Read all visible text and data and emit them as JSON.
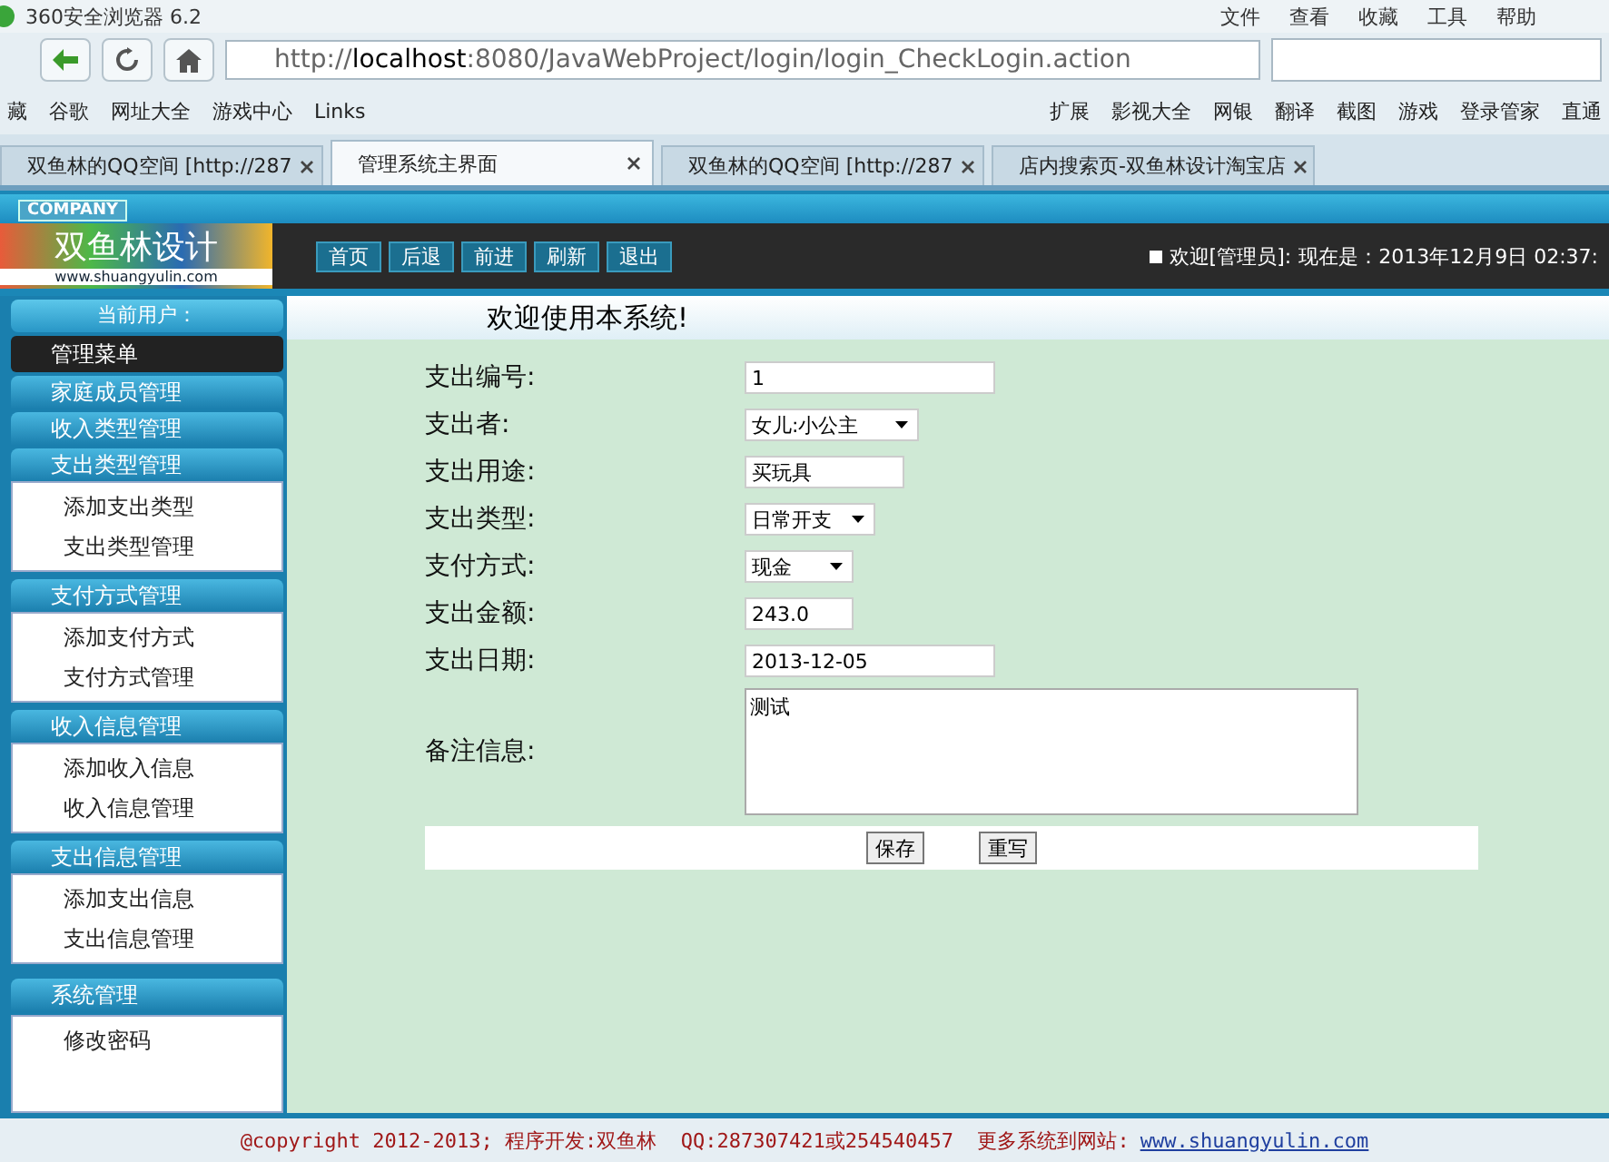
{
  "browser": {
    "title": "360安全浏览器 6.2",
    "menu": [
      "文件",
      "查看",
      "收藏",
      "工具",
      "帮助"
    ],
    "url": "http://**localhost**:8080/JavaWebProject/login/login_CheckLogin.action",
    "bookmarks_left": [
      "藏",
      "谷歌",
      "网址大全",
      "游戏中心",
      "Links"
    ],
    "bookmarks_right": [
      "扩展",
      "影视大全",
      "网银",
      "翻译",
      "截图",
      "游戏",
      "登录管家",
      "直通"
    ],
    "tabs": [
      {
        "label": "双鱼林的QQ空间 [http://287",
        "selected": false
      },
      {
        "label": "管理系统主界面",
        "selected": true
      },
      {
        "label": "双鱼林的QQ空间 [http://287",
        "selected": false
      },
      {
        "label": "店内搜索页-双鱼林设计淘宝店",
        "selected": false
      }
    ]
  },
  "header": {
    "badge": "COMPANY",
    "logo": "双鱼林设计",
    "logo_url": "www.shuangyulin.com",
    "nav": [
      "首页",
      "后退",
      "前进",
      "刷新",
      "退出"
    ],
    "welcome": "欢迎[管理员]:",
    "time": "现在是：2013年12月9日 02:37:"
  },
  "sidebar": {
    "user_label": "当前用户：",
    "menu_title": "管理菜单",
    "groups": [
      {
        "label": "家庭成员管理",
        "expanded": false
      },
      {
        "label": "收入类型管理",
        "expanded": false
      },
      {
        "label": "支出类型管理",
        "expanded": true,
        "children": [
          "添加支出类型",
          "支出类型管理"
        ]
      },
      {
        "label": "支付方式管理",
        "expanded": true,
        "children": [
          "添加支付方式",
          "支付方式管理"
        ]
      },
      {
        "label": "收入信息管理",
        "expanded": true,
        "children": [
          "添加收入信息",
          "收入信息管理"
        ]
      },
      {
        "label": "支出信息管理",
        "expanded": true,
        "children": [
          "添加支出信息",
          "支出信息管理"
        ]
      }
    ],
    "system": {
      "label": "系统管理",
      "children": [
        "修改密码"
      ]
    }
  },
  "main": {
    "title": "欢迎使用本系统!",
    "fields": [
      {
        "kind": "text",
        "label": "支出编号:",
        "value": "1"
      },
      {
        "kind": "select",
        "label": "支出者:",
        "value": "女儿:小公主"
      },
      {
        "kind": "text",
        "label": "支出用途:",
        "value": "买玩具"
      },
      {
        "kind": "select",
        "label": "支出类型:",
        "value": "日常开支"
      },
      {
        "kind": "select",
        "label": "支付方式:",
        "value": "现金"
      },
      {
        "kind": "text",
        "label": "支出金额:",
        "value": "243.0"
      },
      {
        "kind": "text",
        "label": "支出日期:",
        "value": "2013-12-05"
      },
      {
        "kind": "textarea",
        "label": "备注信息:",
        "value": "测试"
      }
    ],
    "buttons": [
      "保存",
      "重写"
    ]
  },
  "footer": {
    "text": "@copyright 2012-2013; 程序开发:双鱼林  QQ:287307421或254540457  更多系统到网站:",
    "link": "www.shuangyulin.com"
  }
}
